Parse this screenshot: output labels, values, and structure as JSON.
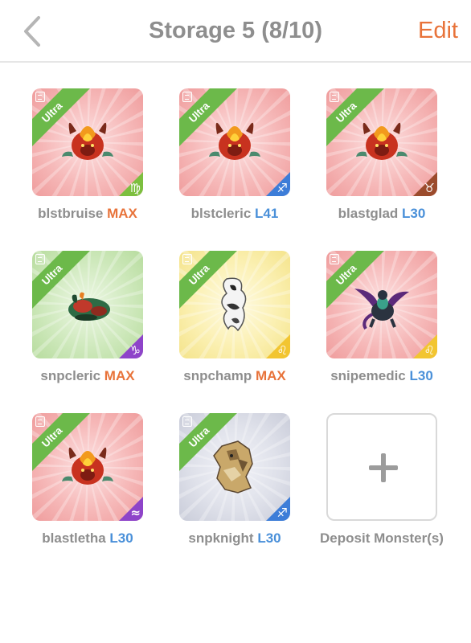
{
  "header": {
    "back_icon": "chevron-left-icon",
    "title": "Storage 5 (8/10)",
    "edit_label": "Edit"
  },
  "colors": {
    "accent_orange": "#e8733a",
    "level_blue": "#4a90d9",
    "ribbon_green": "#6cb94a",
    "text_gray": "#8e8e8e"
  },
  "monsters": [
    {
      "name": "blstbruise",
      "level": "MAX",
      "level_type": "max",
      "rank": "Ultra",
      "bg": "red",
      "sign": "♍",
      "sign_color": "#7cbf3f",
      "art": "fire-dragon"
    },
    {
      "name": "blstcleric",
      "level": "L41",
      "level_type": "num",
      "rank": "Ultra",
      "bg": "red",
      "sign": "♐",
      "sign_color": "#3d7dd8",
      "art": "fire-dragon"
    },
    {
      "name": "blastglad",
      "level": "L30",
      "level_type": "num",
      "rank": "Ultra",
      "bg": "red",
      "sign": "♉",
      "sign_color": "#9b4b2c",
      "art": "fire-dragon"
    },
    {
      "name": "snpcleric",
      "level": "MAX",
      "level_type": "max",
      "rank": "Ultra",
      "bg": "green",
      "sign": "♑",
      "sign_color": "#8e44c9",
      "art": "beetle"
    },
    {
      "name": "snpchamp",
      "level": "MAX",
      "level_type": "max",
      "rank": "Ultra",
      "bg": "yellow",
      "sign": "♌",
      "sign_color": "#f2c531",
      "art": "white-wraith"
    },
    {
      "name": "snipemedic",
      "level": "L30",
      "level_type": "num",
      "rank": "Ultra",
      "bg": "red",
      "sign": "♌",
      "sign_color": "#f2c531",
      "art": "dark-dragon"
    },
    {
      "name": "blastletha",
      "level": "L30",
      "level_type": "num",
      "rank": "Ultra",
      "bg": "red",
      "sign": "≈",
      "sign_color": "#8e44c9",
      "art": "fire-dragon"
    },
    {
      "name": "snpknight",
      "level": "L30",
      "level_type": "num",
      "rank": "Ultra",
      "bg": "silver",
      "sign": "♐",
      "sign_color": "#3d7dd8",
      "art": "rock-golem"
    }
  ],
  "deposit": {
    "label": "Deposit Monster(s)",
    "icon": "plus-icon"
  }
}
